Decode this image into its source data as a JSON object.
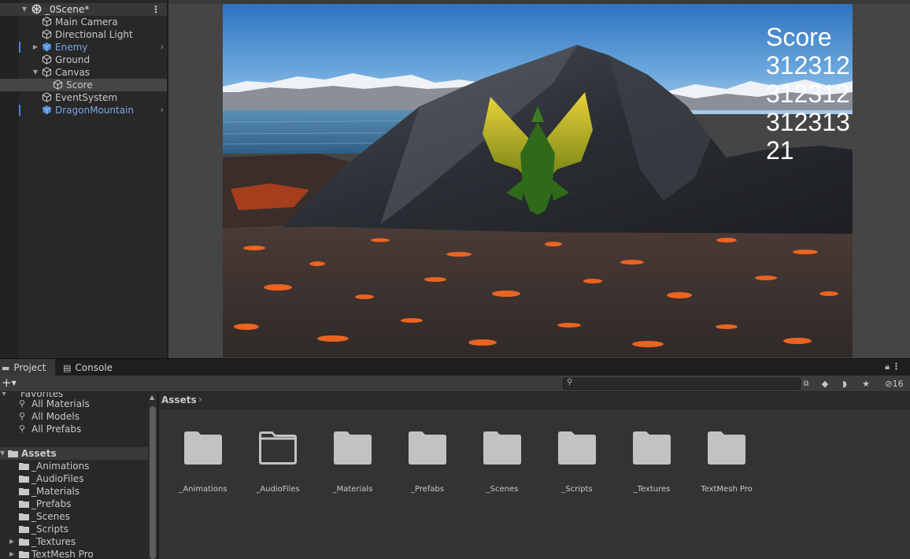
{
  "hierarchy": {
    "scene": "_0Scene*",
    "items": [
      {
        "label": "Main Camera",
        "depth": 1,
        "prefab": false
      },
      {
        "label": "Directional Light",
        "depth": 1,
        "prefab": false
      },
      {
        "label": "Enemy",
        "depth": 1,
        "prefab": true
      },
      {
        "label": "Ground",
        "depth": 1,
        "prefab": false
      },
      {
        "label": "Canvas",
        "depth": 1,
        "prefab": false
      },
      {
        "label": "Score",
        "depth": 2,
        "prefab": false
      },
      {
        "label": "EventSystem",
        "depth": 1,
        "prefab": false
      },
      {
        "label": "DragonMountain",
        "depth": 1,
        "prefab": true
      }
    ]
  },
  "game": {
    "score_lines": "Score\n312312\n312312\n312313\n21"
  },
  "project": {
    "tabs": {
      "project": "Project",
      "console": "Console"
    },
    "add_label": "+",
    "hidden_count": "16",
    "search_placeholder": "",
    "favorites": {
      "header": "Favorites",
      "items": [
        "All Materials",
        "All Models",
        "All Prefabs"
      ]
    },
    "tree": {
      "root": "Assets",
      "children": [
        "_Animations",
        "_AudioFiles",
        "_Materials",
        "_Prefabs",
        "_Scenes",
        "_Scripts",
        "_Textures",
        "TextMesh Pro"
      ]
    },
    "breadcrumb": {
      "root": "Assets"
    },
    "folders": [
      "_Animations",
      "_AudioFiles",
      "_Materials",
      "_Prefabs",
      "_Scenes",
      "_Scripts",
      "_Textures",
      "TextMesh Pro"
    ]
  },
  "colors": {
    "prefab": "#7aa6e6",
    "folder": "#c2c2c2"
  }
}
